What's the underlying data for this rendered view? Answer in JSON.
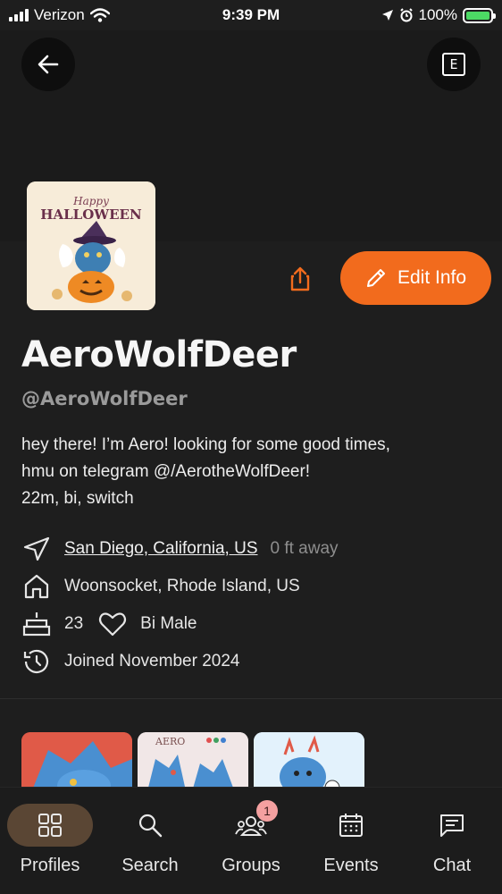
{
  "status_bar": {
    "carrier": "Verizon",
    "time": "9:39 PM",
    "battery": "100%"
  },
  "header": {
    "back_icon": "arrow-left-icon",
    "menu_icon": "e-box-icon",
    "menu_label": "E"
  },
  "profile": {
    "avatar_lettering": "Happy HALLOWEEN",
    "display_name": "AeroWolfDeer",
    "handle": "@AeroWolfDeer",
    "bio_lines": [
      "hey there! I’m Aero! looking for some good times,",
      "hmu on telegram @/AerotheWolfDeer!",
      "22m, bi, switch"
    ],
    "edit_button": "Edit Info",
    "location": "San Diego, California, US",
    "distance": "0 ft away",
    "hometown": "Woonsocket, Rhode Island, US",
    "age": "23",
    "orientation": "Bi Male",
    "joined": "Joined November 2024"
  },
  "gallery": {
    "thumb_2_lettering": "AERO"
  },
  "nav": {
    "items": [
      {
        "label": "Profiles",
        "icon": "grid-icon"
      },
      {
        "label": "Search",
        "icon": "search-icon"
      },
      {
        "label": "Groups",
        "icon": "groups-icon",
        "badge": "1"
      },
      {
        "label": "Events",
        "icon": "calendar-icon"
      },
      {
        "label": "Chat",
        "icon": "chat-icon"
      }
    ]
  },
  "colors": {
    "accent": "#f26b1d",
    "background": "#1e1e1e",
    "active_nav": "#5a4634"
  }
}
